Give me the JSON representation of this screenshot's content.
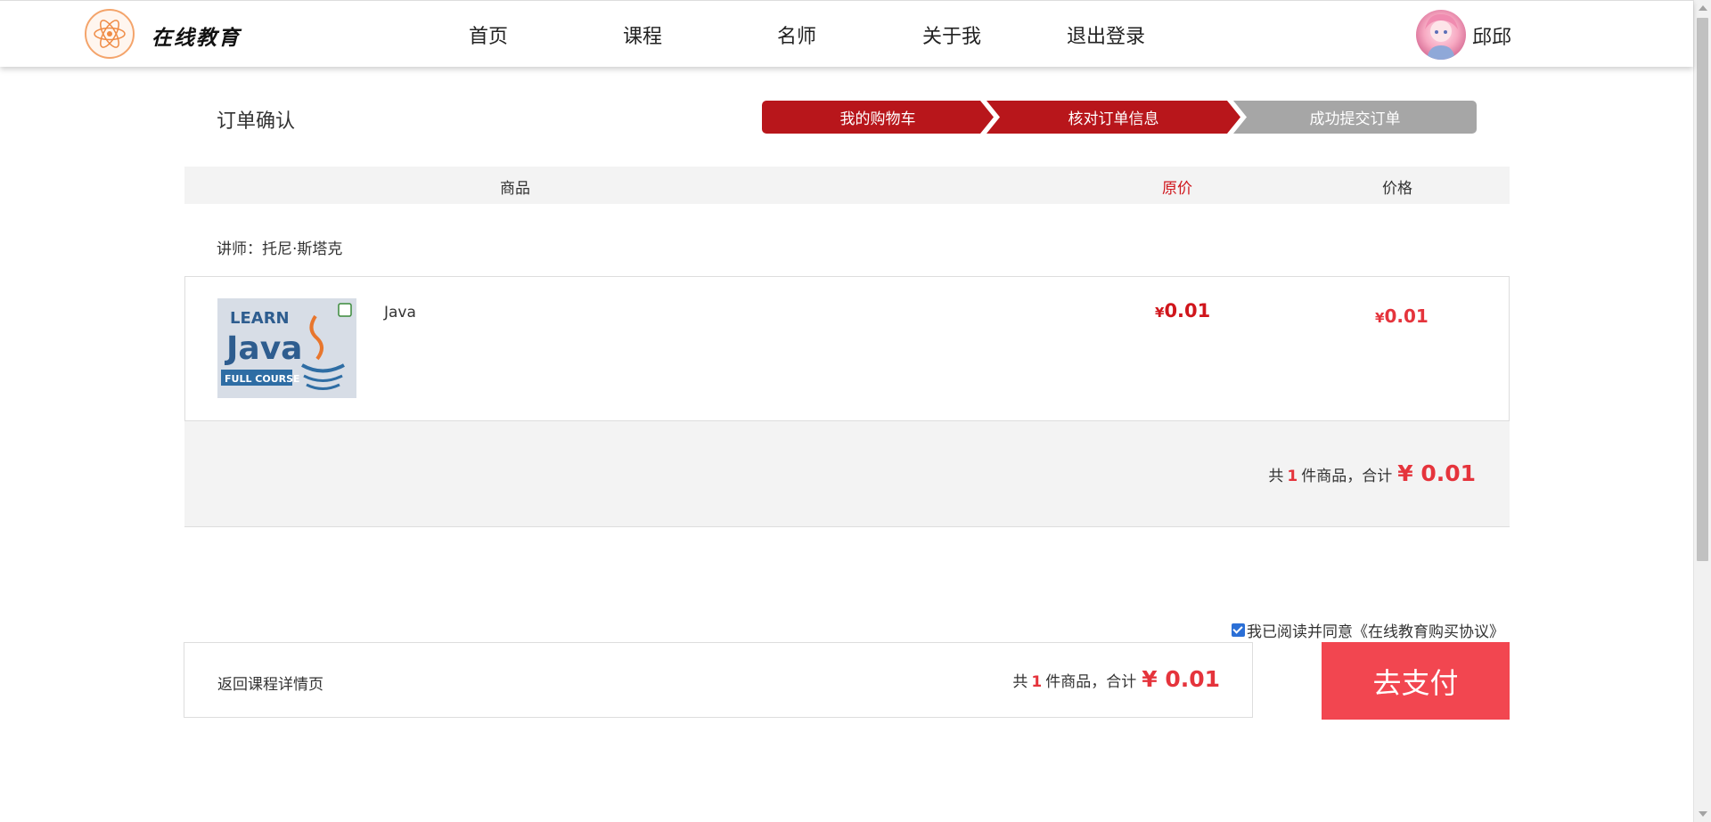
{
  "header": {
    "logo_text": "在线教育",
    "nav": [
      "首页",
      "课程",
      "名师",
      "关于我",
      "退出登录"
    ],
    "username": "邱邱"
  },
  "order": {
    "title": "订单确认",
    "steps": [
      "我的购物车",
      "核对订单信息",
      "成功提交订单"
    ],
    "active_steps": 2
  },
  "table": {
    "col_product": "商品",
    "col_original_price": "原价",
    "col_price": "价格"
  },
  "teacher": "讲师：托尼·斯塔克",
  "item": {
    "thumb_line1": "LEARN",
    "thumb_line2": "Java",
    "thumb_line3": "FULL COURSE",
    "name": "Java",
    "yen": "¥",
    "original_price": "0.01",
    "price": "0.01"
  },
  "summary": {
    "prefix": "共",
    "count": "1",
    "middle": "件商品，合计",
    "total": "¥ 0.01"
  },
  "agreement": {
    "checked": true,
    "text": "我已阅读并同意《在线教育购买协议》"
  },
  "bottom": {
    "back_label": "返回课程详情页",
    "prefix": "共",
    "count": "1",
    "middle": "件商品，合计",
    "total": "¥ 0.01",
    "pay_label": "去支付"
  },
  "colors": {
    "brand_red": "#b8161b",
    "price_red": "#e5343c",
    "pay_button": "#f24650",
    "step_inactive": "#a6a6a6"
  }
}
